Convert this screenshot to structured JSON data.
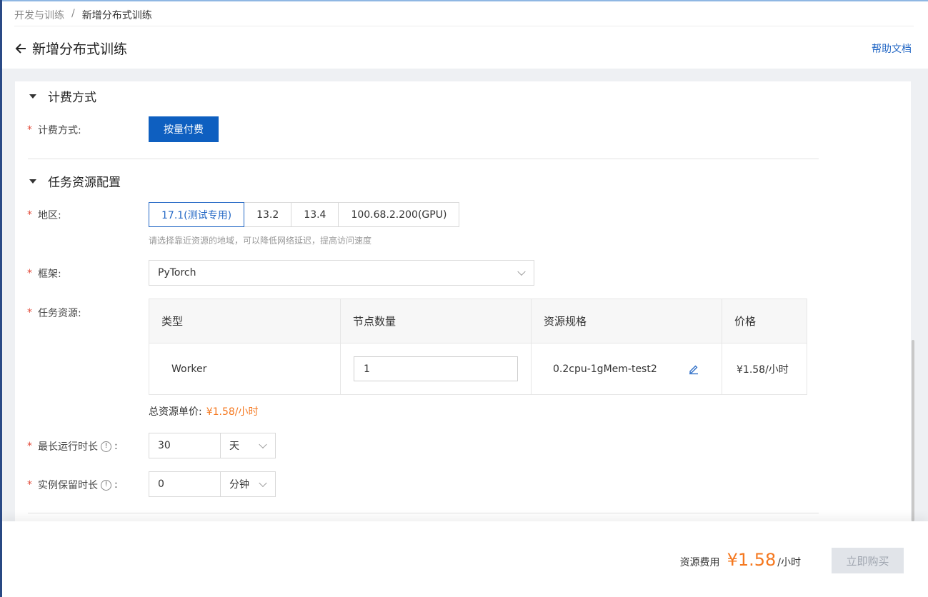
{
  "breadcrumb": {
    "parent": "开发与训练",
    "separator": "/",
    "current": "新增分布式训练"
  },
  "header": {
    "title": "新增分布式训练",
    "help_link": "帮助文档"
  },
  "billing_section": {
    "title": "计费方式",
    "field_label": "计费方式:",
    "option": "按量付费"
  },
  "resource_section": {
    "title": "任务资源配置",
    "region": {
      "label": "地区:",
      "options": [
        "17.1(测试专用)",
        "13.2",
        "13.4",
        "100.68.2.200(GPU)"
      ],
      "selected": "17.1(测试专用)",
      "hint": "请选择靠近资源的地域，可以降低网络延迟，提高访问速度"
    },
    "framework": {
      "label": "框架:",
      "value": "PyTorch"
    },
    "task_resource": {
      "label": "任务资源:",
      "columns": [
        "类型",
        "节点数量",
        "资源规格",
        "价格"
      ],
      "rows": [
        {
          "type": "Worker",
          "nodes": "1",
          "spec": "0.2cpu-1gMem-test2",
          "price": "¥1.58/小时"
        }
      ],
      "total_label": "总资源单价:",
      "total_value": "¥1.58/小时"
    },
    "max_runtime": {
      "label": "最长运行时长",
      "colon": ":",
      "value": "30",
      "unit": "天"
    },
    "instance_retention": {
      "label": "实例保留时长",
      "colon": ":",
      "value": "0",
      "unit": "分钟"
    }
  },
  "footer": {
    "fee_label": "资源费用",
    "fee_value": "¥1.58",
    "fee_unit": "/小时",
    "buy_button": "立即购买"
  },
  "colors": {
    "primary": "#0e5fc0",
    "link": "#2468c5",
    "price": "#f5781f",
    "required": "#e34b3a"
  },
  "icons": [
    "arrow-left-icon",
    "caret-down-icon",
    "chevron-down-icon",
    "info-icon",
    "edit-pencil-icon"
  ]
}
